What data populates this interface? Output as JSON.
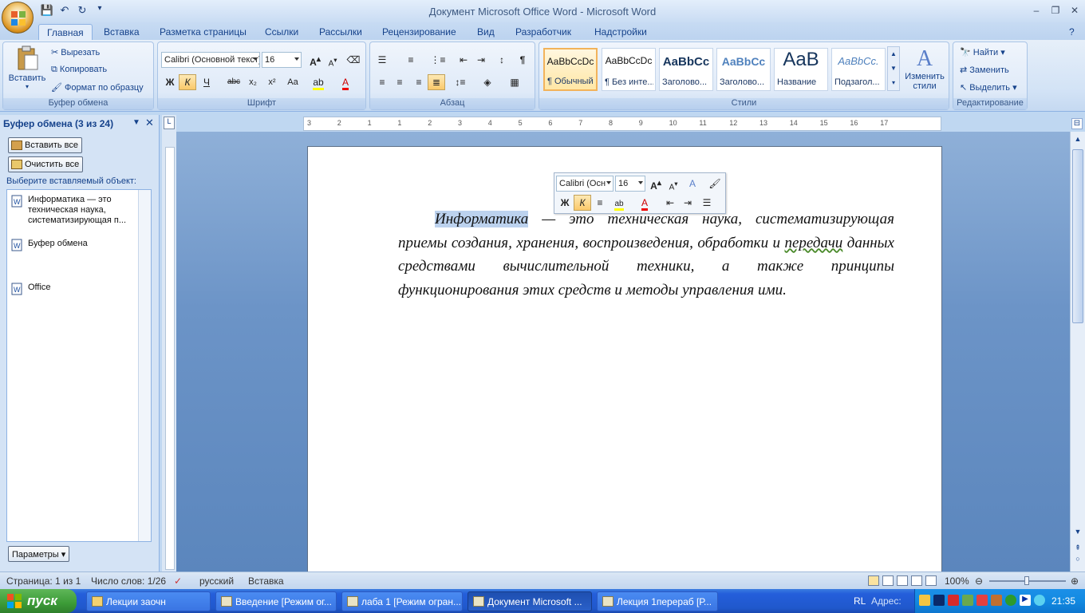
{
  "window": {
    "title": "Документ Microsoft Office Word - Microsoft Word",
    "controls": [
      "minimize",
      "restore",
      "close"
    ]
  },
  "ribbon_tabs": [
    "Главная",
    "Вставка",
    "Разметка страницы",
    "Ссылки",
    "Рассылки",
    "Рецензирование",
    "Вид",
    "Разработчик",
    "Надстройки"
  ],
  "active_tab": "Главная",
  "clipboard_group": {
    "label": "Буфер обмена",
    "paste": "Вставить",
    "cut": "Вырезать",
    "copy": "Копировать",
    "format_painter": "Формат по образцу"
  },
  "font_group": {
    "label": "Шрифт",
    "font_name": "Calibri (Основной текст)",
    "font_size": "16",
    "bold": "Ж",
    "italic": "К",
    "underline": "Ч",
    "strike": "abc",
    "subscript": "x₂",
    "superscript": "x²",
    "case": "Aa"
  },
  "paragraph_group": {
    "label": "Абзац"
  },
  "styles_group": {
    "label": "Стили",
    "styles": [
      {
        "sample": "AaBbCcDc",
        "name": "¶ Обычный"
      },
      {
        "sample": "AaBbCcDc",
        "name": "¶ Без инте..."
      },
      {
        "sample": "AaBbCc",
        "name": "Заголово..."
      },
      {
        "sample": "AaBbCc",
        "name": "Заголово..."
      },
      {
        "sample": "AaB",
        "name": "Название"
      },
      {
        "sample": "AaBbCc.",
        "name": "Подзагол..."
      }
    ],
    "change_styles": "Изменить стили"
  },
  "editing_group": {
    "label": "Редактирование",
    "find": "Найти",
    "replace": "Заменить",
    "select": "Выделить"
  },
  "task_pane": {
    "title": "Буфер обмена (3 из 24)",
    "paste_all": "Вставить все",
    "clear_all": "Очистить все",
    "prompt": "Выберите вставляемый объект:",
    "items": [
      "Информатика — это техническая наука, систематизирующая п...",
      "Буфер обмена",
      "Office"
    ],
    "options_button": "Параметры"
  },
  "ruler_numbers": [
    "3",
    "2",
    "1",
    "1",
    "2",
    "3",
    "4",
    "5",
    "6",
    "7",
    "8",
    "9",
    "10",
    "11",
    "12",
    "13",
    "14",
    "15",
    "16",
    "17"
  ],
  "mini_toolbar": {
    "font": "Calibri (Осн",
    "size": "16"
  },
  "document": {
    "highlighted_word": "Информатика",
    "text_before_squiggle": " — это техническая наука, систематизирующая приемы создания, хранения, воспроизведения, обработки и ",
    "squiggle_word": "передачи",
    "text_after": " данных средствами вычислительной техники, а также принципы функционирования этих средств и методы управления ими."
  },
  "status_bar": {
    "page": "Страница: 1 из 1",
    "words": "Число слов: 1/26",
    "language": "русский",
    "mode": "Вставка",
    "zoom": "100%"
  },
  "taskbar": {
    "start": "пуск",
    "tasks": [
      {
        "label": "Лекции заочн",
        "active": false
      },
      {
        "label": "Введение [Режим ог...",
        "active": false
      },
      {
        "label": "лаба 1 [Режим огран...",
        "active": false
      },
      {
        "label": "Документ Microsoft ...",
        "active": true
      },
      {
        "label": "Лекция 1перераб [Р...",
        "active": false
      }
    ],
    "lang": "RL",
    "address": "Адрес:",
    "clock": "21:35"
  },
  "colors": {
    "ribbon_bg": "#dfeaf8",
    "selection": "#bcd2ee",
    "taskbar": "#245edb",
    "start_green": "#3c9b37"
  }
}
